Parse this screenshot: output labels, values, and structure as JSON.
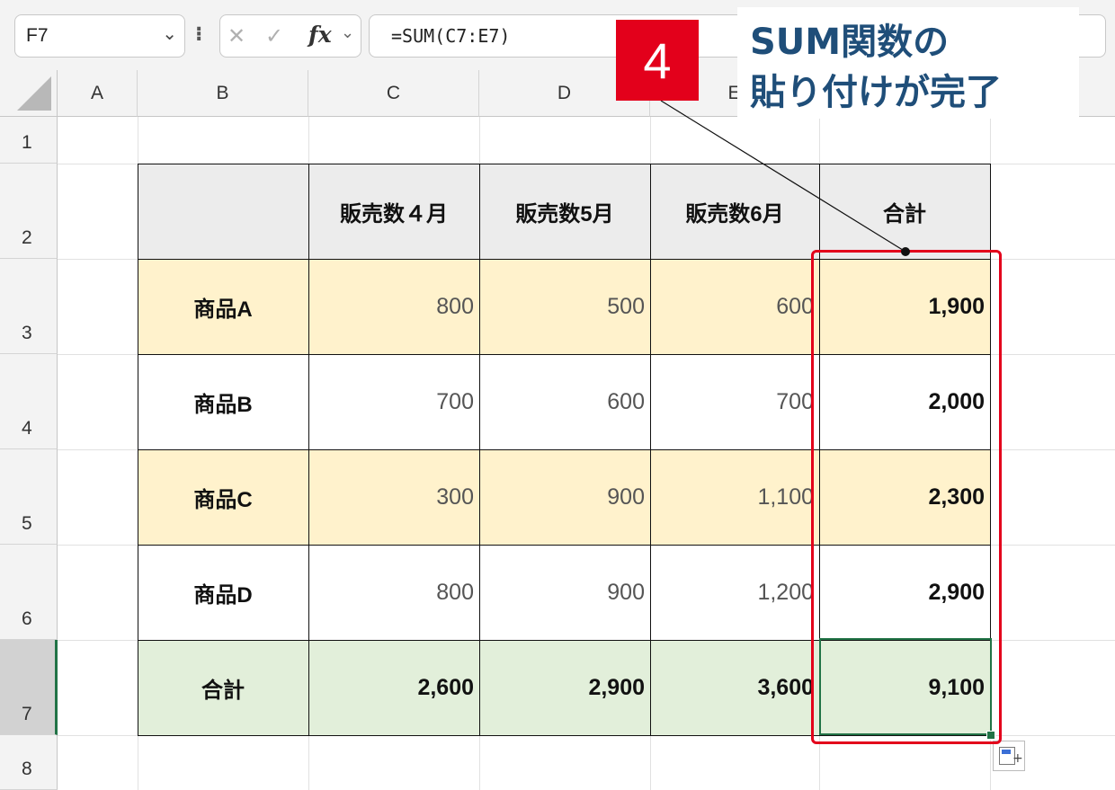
{
  "formula_bar": {
    "name_box": "F7",
    "chevron": "⌄",
    "more": "⁝",
    "cancel": "✕",
    "enter": "✓",
    "fx": "fx",
    "fx_chevron": "⌄",
    "formula": "=SUM(C7:E7)"
  },
  "columns": [
    "A",
    "B",
    "C",
    "D",
    "E"
  ],
  "rows": [
    "1",
    "2",
    "3",
    "4",
    "5",
    "6",
    "7",
    "8"
  ],
  "active_row": "7",
  "table": {
    "header": [
      "",
      "販売数４月",
      "販売数5月",
      "販売数6月",
      "合計"
    ],
    "products": [
      {
        "label": "商品A",
        "values": [
          "800",
          "500",
          "600"
        ],
        "total": "1,900"
      },
      {
        "label": "商品B",
        "values": [
          "700",
          "600",
          "700"
        ],
        "total": "2,000"
      },
      {
        "label": "商品C",
        "values": [
          "300",
          "900",
          "1,100"
        ],
        "total": "2,300"
      },
      {
        "label": "商品D",
        "values": [
          "800",
          "900",
          "1,200"
        ],
        "total": "2,900"
      }
    ],
    "total_row": {
      "label": "合計",
      "values": [
        "2,600",
        "2,900",
        "3,600"
      ],
      "total": "9,100"
    }
  },
  "annotation": {
    "step": "4",
    "line1": "SUM関数の",
    "line2": "貼り付けが完了"
  },
  "colors": {
    "header_fill": "#ececec",
    "yellow_fill": "#fff2cc",
    "green_fill": "#e2efda",
    "highlight_red": "#e3001b",
    "excel_green": "#217346",
    "callout_text": "#1f4e79"
  },
  "icons": {
    "cancel": "cancel-icon",
    "enter": "enter-icon",
    "fx": "fx-icon",
    "corner": "select-all-icon",
    "paste_options": "paste-options-icon"
  }
}
